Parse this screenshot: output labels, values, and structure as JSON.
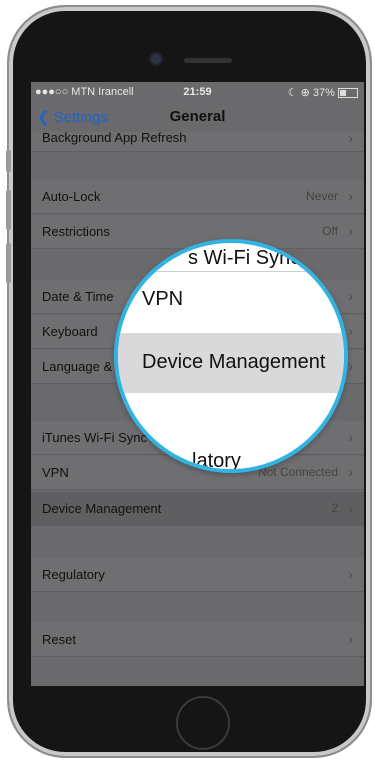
{
  "status": {
    "carrier": "●●●○○ MTN Irancell",
    "time": "21:59",
    "battery": "37%"
  },
  "nav": {
    "back_label": "Settings",
    "title": "General"
  },
  "rows": {
    "background_refresh": "Background App Refresh",
    "auto_lock": {
      "label": "Auto-Lock",
      "value": "Never"
    },
    "restrictions": {
      "label": "Restrictions",
      "value": "Off"
    },
    "date_time": "Date & Time",
    "keyboard": "Keyboard",
    "language": "Language &",
    "itunes": "iTunes Wi-Fi Sync",
    "vpn": {
      "label": "VPN",
      "value": "Not Connected"
    },
    "device_mgmt": {
      "label": "Device Management",
      "value": "2"
    },
    "regulatory": "Regulatory",
    "reset": "Reset"
  },
  "magnifier": {
    "top_fragment": "s Wi-Fi Sync",
    "vpn": "VPN",
    "device_mgmt": "Device Management",
    "bottom_fragment": "latory"
  }
}
